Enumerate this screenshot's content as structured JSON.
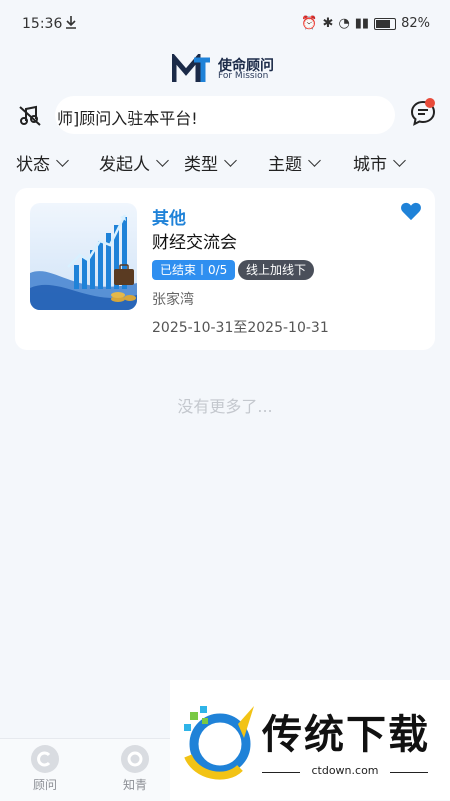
{
  "status_bar": {
    "time": "15:36",
    "battery": "82%"
  },
  "header": {
    "logo_cn": "使命顾问",
    "logo_en": "For Mission"
  },
  "notice": {
    "text": "师]顾问入驻本平台!"
  },
  "filters": [
    "状态",
    "发起人",
    "类型",
    "主题",
    "城市"
  ],
  "event": {
    "category": "其他",
    "title": "财经交流会",
    "status": "已结束丨0/5",
    "mode": "线上加线下",
    "location": "张家湾",
    "date_range": "2025-10-31至2025-10-31"
  },
  "list_end": "没有更多了...",
  "tabbar": {
    "items": [
      {
        "label": "顾问"
      },
      {
        "label": "知青"
      }
    ]
  },
  "watermark": {
    "title": "传统下载",
    "url": "ctdown.com"
  },
  "colors": {
    "accent": "#1f82d8",
    "background": "#f4f7fb",
    "badge_dark": "#4a4f5a"
  }
}
